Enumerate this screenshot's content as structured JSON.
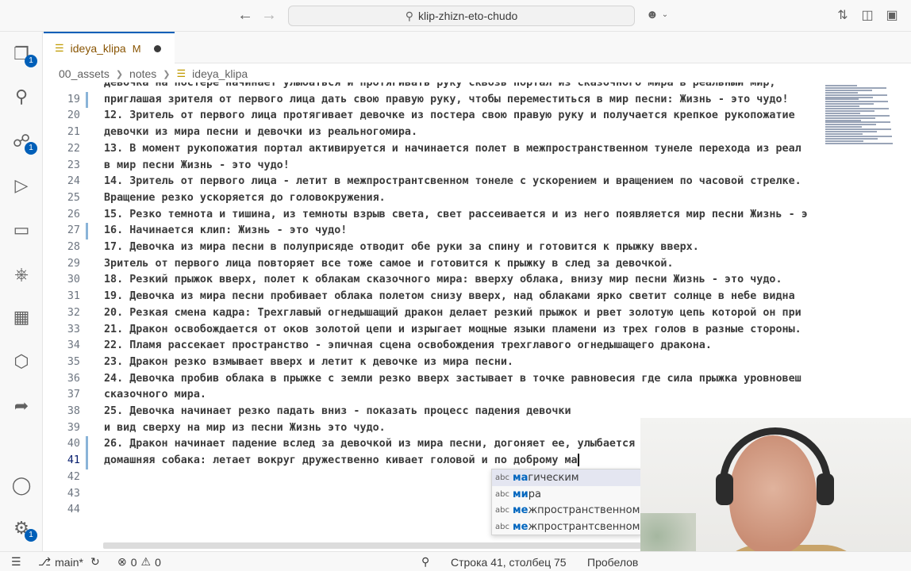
{
  "titlebar": {
    "search_text": "klip-zhizn-eto-chudo",
    "back_glyph": "←",
    "forward_glyph": "→"
  },
  "activity": {
    "explorer_badge": "1",
    "scm_badge": "1",
    "settings_badge": "1"
  },
  "tab": {
    "name": "ideya_klipa",
    "status": "M"
  },
  "breadcrumb": [
    "00_assets",
    "notes",
    "ideya_klipa"
  ],
  "editor": {
    "lines": [
      {
        "n": "",
        "text": "Девочка на постере начинает улыбаться и протягивать руку сквозь портал из сказочного мира в реальный мир,"
      },
      {
        "n": "19",
        "text": "приглашая зрителя от первого лица дать свою правую руку, чтобы переместиться в мир песни: Жизнь - это чудо!"
      },
      {
        "n": "20",
        "text": "12. Зритель от первого лица протягивает девочке из постера свою правую руку и получается крепкое рукопожатие"
      },
      {
        "n": "21",
        "text": "девочки из мира песни и девочки из реальногомира."
      },
      {
        "n": "22",
        "text": "13. В момент рукопожатия портал активируется и начинается полет в межпространственном тунеле перехода из реал"
      },
      {
        "n": "23",
        "text": "в мир песни Жизнь - это чудо!"
      },
      {
        "n": "24",
        "text": "14. Зритель от первого лица - летит в межпространтсвенном тонеле с ускорением и вращением по часовой стрелке."
      },
      {
        "n": "25",
        "text": "Вращение резко ускоряется до головокружения."
      },
      {
        "n": "26",
        "text": "15. Резко темнота и тишина, из темноты взрыв света, свет рассеивается и из него появляется мир песни Жизнь - э"
      },
      {
        "n": "27",
        "text": "16. Начинается клип: Жизнь - это чудо!"
      },
      {
        "n": "28",
        "text": "17. Девочка из мира песни в полуприсяде отводит обе руки за спину и готовится к прыжку вверх."
      },
      {
        "n": "29",
        "text": "Зритель от первого лица повторяет все тоже самое и готовится к прыжку в след за девочкой."
      },
      {
        "n": "30",
        "text": "18. Резкий прыжок вверх, полет к облакам сказочного мира: вверху облака, внизу мир песни Жизнь - это чудо."
      },
      {
        "n": "31",
        "text": "19. Девочка из мира песни пробивает облака полетом снизу вверх, над облаками ярко светит солнце в небе видна"
      },
      {
        "n": "32",
        "text": "20. Резкая смена кадра: Трехглавый огнедышащий дракон делает резкий прыжок и рвет золотую цепь которой он при"
      },
      {
        "n": "33",
        "text": "21. Дракон освобождается от оков золотой цепи и изрыгает мощные языки пламени из трех голов в разные стороны."
      },
      {
        "n": "34",
        "text": "22. Пламя рассекает пространство - эпичная сцена освобождения трехглавого огнедышащего дракона."
      },
      {
        "n": "35",
        "text": "23. Дракон резко взмывает вверх и летит к девочке из мира песни."
      },
      {
        "n": "36",
        "text": "24. Девочка пробив облака в прыжке с земли резко вверх застывает в точке равновесия где сила прыжка уровновеш"
      },
      {
        "n": "37",
        "text": "сказочного мира."
      },
      {
        "n": "38",
        "text": "25. Девочка начинает резко падать вниз - показать процесс падения девочки"
      },
      {
        "n": "39",
        "text": "и вид сверху на мир из песни Жизнь это чудо."
      },
      {
        "n": "40",
        "text": "26. Дракон начинает падение вслед за девочкой из мира песни, догоняет ее, улыбается"
      },
      {
        "n": "41",
        "text": "домашняя собака: летает вокруг дружественно кивает головой и по доброму ма"
      },
      {
        "n": "42",
        "text": ""
      },
      {
        "n": "43",
        "text": ""
      },
      {
        "n": "44",
        "text": ""
      }
    ]
  },
  "suggest": [
    {
      "kind": "abc",
      "match": "ма",
      "rest": "гическим"
    },
    {
      "kind": "abc",
      "match": "",
      "pre": "",
      "text": "мира"
    },
    {
      "kind": "abc",
      "text": "межпространственном"
    },
    {
      "kind": "abc",
      "text": "межпрострaнтсвенном"
    }
  ],
  "suggest_text": [
    "магическим",
    "мира",
    "межпространственном",
    "межпространтсвенном"
  ],
  "status": {
    "branch": "main*",
    "errors": "0",
    "warnings": "0",
    "position": "Строка 41, столбец 75",
    "indent": "Пробелов"
  }
}
